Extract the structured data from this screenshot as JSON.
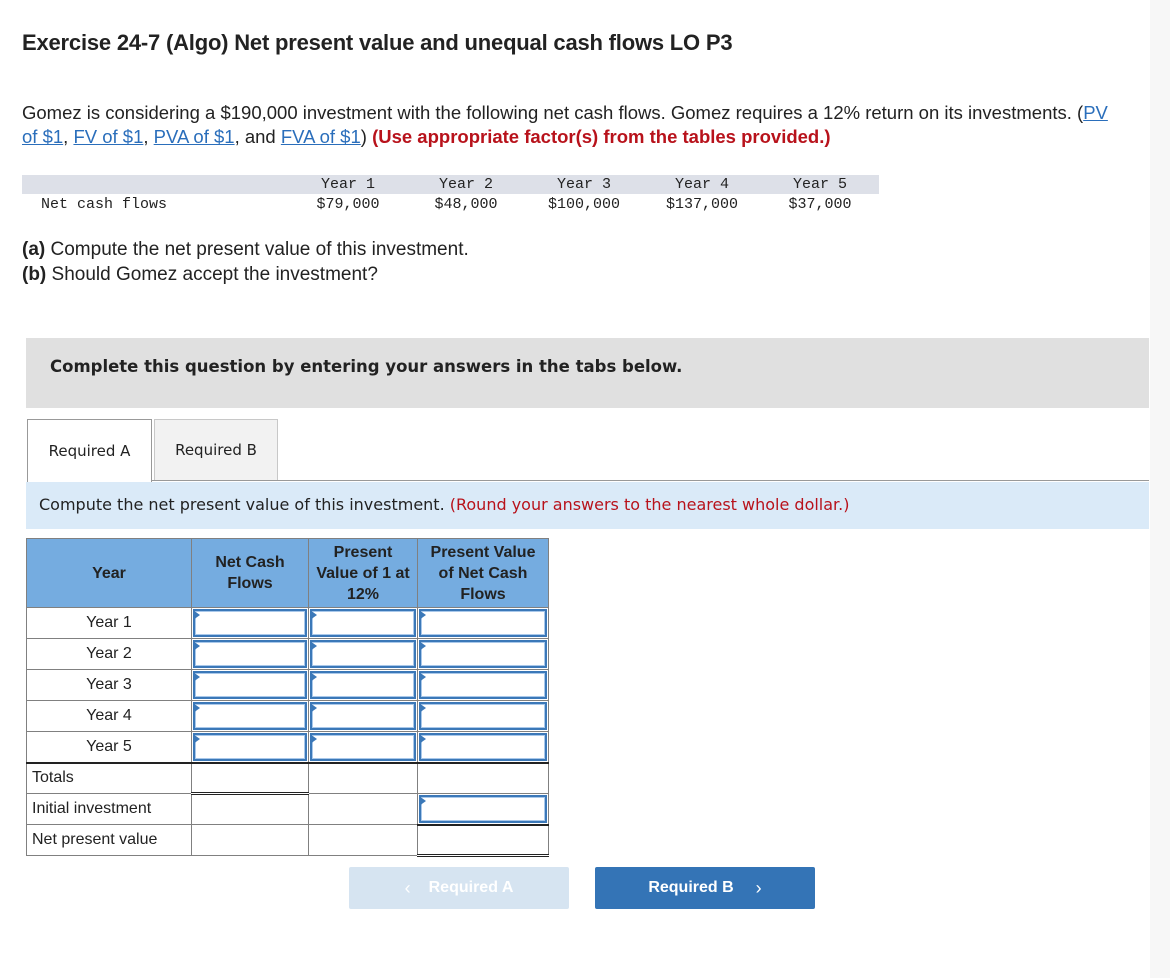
{
  "title": "Exercise 24-7 (Algo) Net present value and unequal cash flows LO P3",
  "intro": {
    "text_1": "Gomez is considering a $190,000 investment with the following net cash flows. Gomez requires a 12% return on its investments. (",
    "links": [
      "PV of $1",
      "FV of $1",
      "PVA of $1",
      "FVA of $1"
    ],
    "sep_1": ", ",
    "sep_2": ", ",
    "sep_3": ", and ",
    "text_2": ") ",
    "instruction": "(Use appropriate factor(s) from the tables provided.)"
  },
  "cash_flows": {
    "row_label": "Net cash flows",
    "years": [
      "Year 1",
      "Year 2",
      "Year 3",
      "Year 4",
      "Year 5"
    ],
    "values": [
      "$79,000",
      "$48,000",
      "$100,000",
      "$137,000",
      "$37,000"
    ]
  },
  "questions": {
    "a_label": "(a)",
    "a_text": " Compute the net present value of this investment.",
    "b_label": "(b)",
    "b_text": " Should Gomez accept the investment?"
  },
  "banner": "Complete this question by entering your answers in the tabs below.",
  "tabs": [
    {
      "label": "Required A",
      "active": true
    },
    {
      "label": "Required B",
      "active": false
    }
  ],
  "instruction": {
    "text": "Compute the net present value of this investment. ",
    "note": "(Round your answers to the nearest whole dollar.)"
  },
  "npv_table": {
    "headers": [
      "Year",
      "Net Cash Flows",
      "Present Value of 1 at 12%",
      "Present Value of Net Cash Flows"
    ],
    "year_rows": [
      {
        "label": "Year 1",
        "net_cash_flow": "",
        "pv_factor": "",
        "pv_cash_flow": ""
      },
      {
        "label": "Year 2",
        "net_cash_flow": "",
        "pv_factor": "",
        "pv_cash_flow": ""
      },
      {
        "label": "Year 3",
        "net_cash_flow": "",
        "pv_factor": "",
        "pv_cash_flow": ""
      },
      {
        "label": "Year 4",
        "net_cash_flow": "",
        "pv_factor": "",
        "pv_cash_flow": ""
      },
      {
        "label": "Year 5",
        "net_cash_flow": "",
        "pv_factor": "",
        "pv_cash_flow": ""
      }
    ],
    "totals_label": "Totals",
    "initial_investment_label": "Initial investment",
    "initial_investment_value": "",
    "npv_label": "Net present value"
  },
  "nav": {
    "prev_label": "Required A",
    "next_label": "Required B",
    "prev_icon": "‹",
    "next_icon": "›"
  }
}
